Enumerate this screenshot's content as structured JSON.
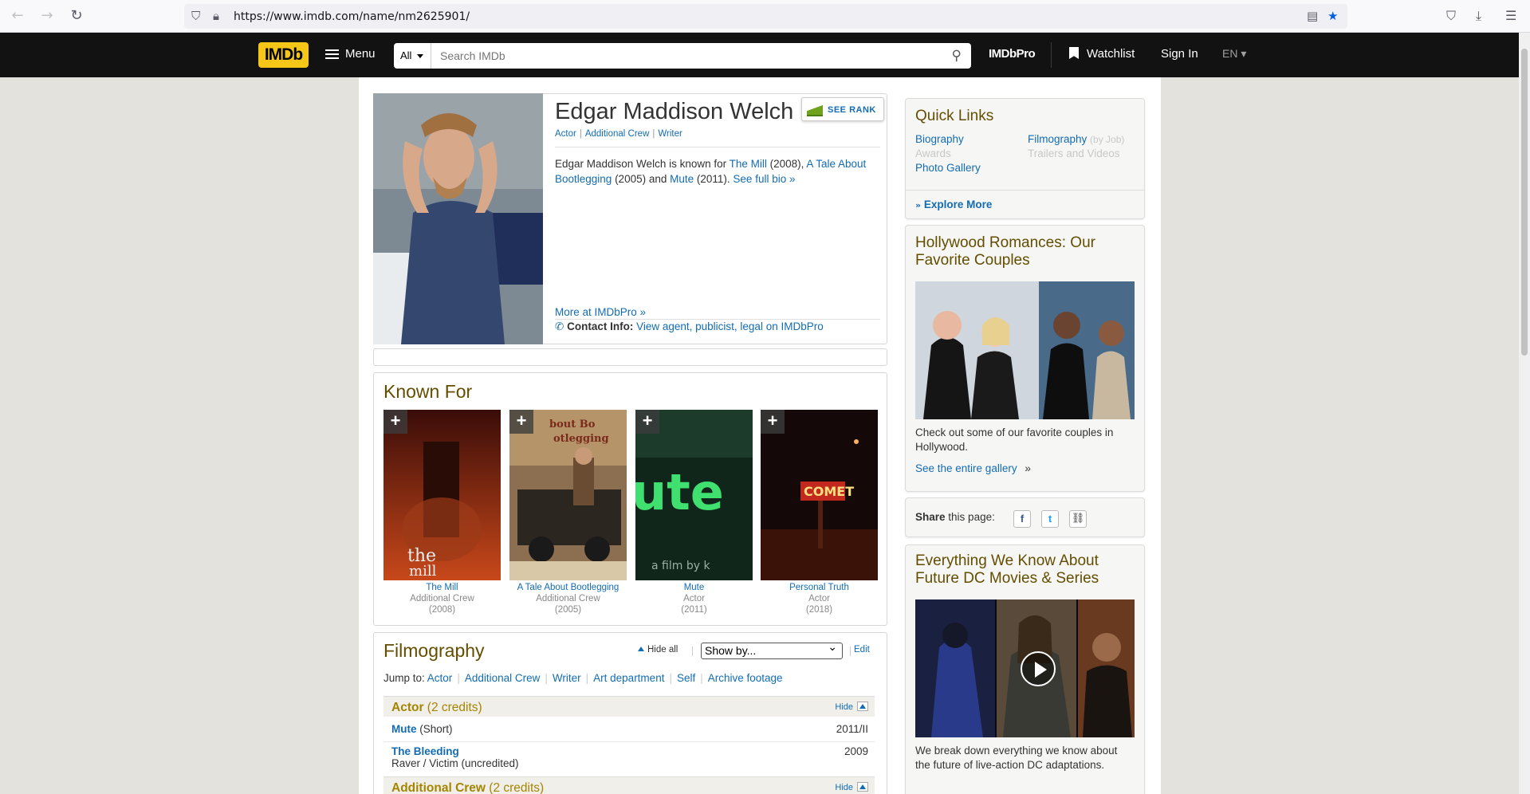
{
  "browser": {
    "url": "https://www.imdb.com/name/nm2625901/",
    "back_icon": "←",
    "forward_icon": "→",
    "reload_icon": "↻"
  },
  "header": {
    "logo": "IMDb",
    "menu_label": "Menu",
    "search_category": "All",
    "search_placeholder": "Search IMDb",
    "imdbpro_label": "IMDbPro",
    "watchlist_label": "Watchlist",
    "signin_label": "Sign In",
    "language": "EN ▾"
  },
  "person": {
    "name": "Edgar Maddison Welch",
    "see_rank": "SEE RANK",
    "roles": [
      "Actor",
      "Additional Crew",
      "Writer"
    ],
    "bio_prefix": "Edgar Maddison Welch is known for ",
    "bio_film1": "The Mill",
    "bio_year1": " (2008), ",
    "bio_film2": "A Tale About Bootlegging",
    "bio_year2": " (2005) and ",
    "bio_film3": "Mute",
    "bio_year3": " (2011). ",
    "bio_more": "See full bio »",
    "more_pro": "More at IMDbPro »",
    "contact_label": "Contact Info:",
    "contact_link": "View agent, publicist, legal on IMDbPro"
  },
  "known_for": {
    "title": "Known For",
    "items": [
      {
        "title": "The Mill",
        "role": "Additional Crew",
        "year": "(2008)"
      },
      {
        "title": "A Tale About Bootlegging",
        "role": "Additional Crew",
        "year": "(2005)"
      },
      {
        "title": "Mute",
        "role": "Actor",
        "year": "(2011)"
      },
      {
        "title": "Personal Truth",
        "role": "Actor",
        "year": "(2018)"
      }
    ]
  },
  "filmography": {
    "title": "Filmography",
    "hide_all": "Hide all",
    "show_by": "Show by...",
    "edit": "Edit",
    "jump_to_label": "Jump to:",
    "jump_links": [
      "Actor",
      "Additional Crew",
      "Writer",
      "Art department",
      "Self",
      "Archive footage"
    ],
    "actor_header": "Actor",
    "actor_count": "(2 credits)",
    "hide_label": "Hide",
    "rows": [
      {
        "title": "Mute",
        "note": "(Short)",
        "year": "2011/II"
      },
      {
        "title": "The Bleeding",
        "note": "Raver / Victim (uncredited)",
        "year": "2009"
      }
    ],
    "crew_header": "Additional Crew",
    "crew_count": "(2 credits)"
  },
  "sidebar": {
    "quick_links_title": "Quick Links",
    "biography": "Biography",
    "awards": "Awards",
    "photo_gallery": "Photo Gallery",
    "filmography": "Filmography",
    "by_job": "(by Job)",
    "trailers": "Trailers and Videos",
    "explore_more": "Explore More",
    "romances_title": "Hollywood Romances: Our Favorite Couples",
    "romances_text": "Check out some of our favorite couples in Hollywood.",
    "romances_link": "See the entire gallery",
    "share_label": "Share",
    "share_suffix": "this page:",
    "dc_title": "Everything We Know About Future DC Movies & Series",
    "dc_text": "We break down everything we know about the future of live-action DC adaptations."
  },
  "colors": {
    "brand": "#f5c518",
    "link": "#136cb2",
    "section_title": "#634e00",
    "category": "#a58500"
  }
}
